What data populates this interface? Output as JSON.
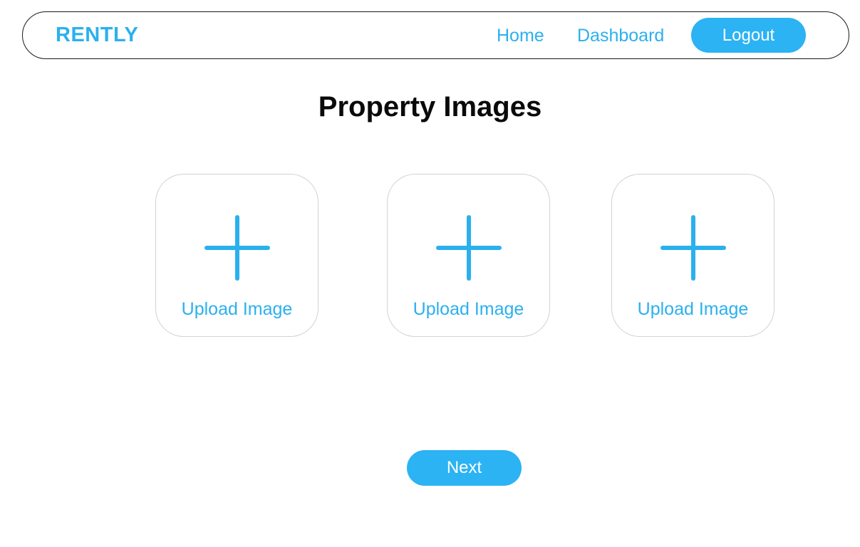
{
  "header": {
    "logo": "RENTLY",
    "nav": {
      "home": "Home",
      "dashboard": "Dashboard"
    },
    "logout_label": "Logout"
  },
  "main": {
    "title": "Property Images",
    "upload_cards": [
      {
        "label": "Upload Image",
        "icon": "plus-icon"
      },
      {
        "label": "Upload Image",
        "icon": "plus-icon"
      },
      {
        "label": "Upload Image",
        "icon": "plus-icon"
      }
    ],
    "next_label": "Next"
  },
  "colors": {
    "accent": "#2bb0ee",
    "button_bg": "#2bb3f3",
    "title_text": "#0a0a0a",
    "card_border": "#d2d2d2"
  }
}
